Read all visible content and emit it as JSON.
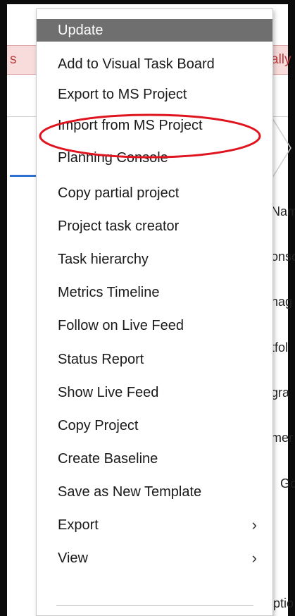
{
  "background": {
    "banner_left": "s",
    "banner_right": "ally",
    "field_labels": [
      "Nam",
      "onso",
      "nag",
      "tfol",
      "gra",
      "mer",
      "Go",
      "ptio"
    ]
  },
  "menu": {
    "items": [
      {
        "label": "Update",
        "selected": true
      },
      {
        "label": "Add to Visual Task Board"
      },
      {
        "label": "Export to MS Project"
      },
      {
        "label": "Import from MS Project"
      },
      {
        "label": "Planning Console"
      },
      {
        "label": "Copy partial project"
      },
      {
        "label": "Project task creator"
      },
      {
        "label": "Task hierarchy"
      },
      {
        "label": "Metrics Timeline"
      },
      {
        "label": "Follow on Live Feed"
      },
      {
        "label": "Status Report"
      },
      {
        "label": "Show Live Feed"
      },
      {
        "label": "Copy Project"
      },
      {
        "label": "Create Baseline"
      },
      {
        "label": "Save as New Template"
      },
      {
        "label": "Export",
        "submenu": true
      },
      {
        "label": "View",
        "submenu": true
      }
    ],
    "submenu_icon": "chevron-right-icon",
    "submenu_glyph": "›"
  },
  "annotation": {
    "highlighted_item": "Import from MS Project",
    "color": "#e0141e"
  },
  "colors": {
    "selected_bg": "#6f6f6f",
    "banner_bg": "#f8dcdc",
    "banner_text": "#b83b3b",
    "tab_accent": "#2f6fd1"
  }
}
